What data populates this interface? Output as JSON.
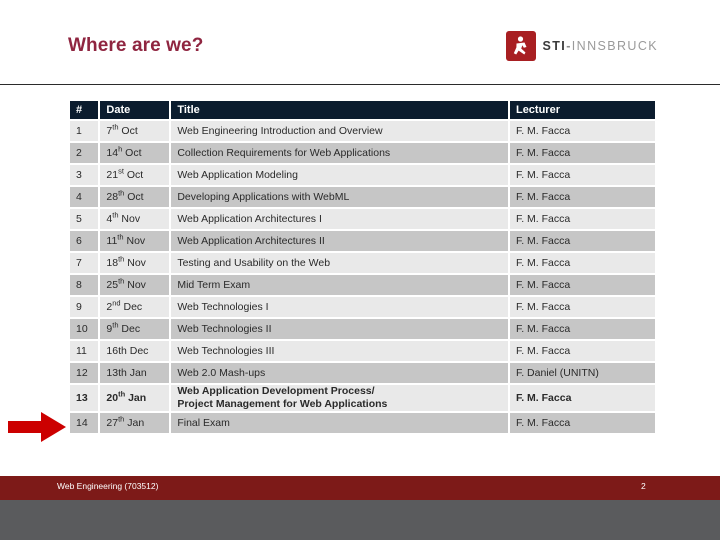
{
  "slide": {
    "title": "Where are we?",
    "brand": {
      "mark_icon": "sti-runner-logo-icon",
      "mark_color": "#a81f22",
      "name": "STI",
      "separator": "-",
      "city": "INNSBRUCK"
    }
  },
  "table": {
    "columns": [
      "#",
      "Date",
      "Title",
      "Lecturer"
    ],
    "header_bg": "#0b1c2e",
    "row_light_bg": "#e9e9e9",
    "row_dark_bg": "#c6c6c6",
    "highlight_color": "#ea1c1c",
    "rows": [
      {
        "num": "1",
        "date_num": "7",
        "date_sup": "th",
        "date_rest": " Oct",
        "title": "Web Engineering Introduction and Overview",
        "lecturer": "F. M. Facca"
      },
      {
        "num": "2",
        "date_num": "14",
        "date_sup": "h",
        "date_rest": " Oct",
        "title": "Collection Requirements for Web Applications",
        "lecturer": "F. M. Facca"
      },
      {
        "num": "3",
        "date_num": "21",
        "date_sup": "st",
        "date_rest": " Oct",
        "title": "Web Application Modeling",
        "lecturer": "F. M. Facca"
      },
      {
        "num": "4",
        "date_num": "28",
        "date_sup": "th",
        "date_rest": " Oct",
        "title": "Developing Applications with WebML",
        "lecturer": "F. M. Facca"
      },
      {
        "num": "5",
        "date_num": "4",
        "date_sup": "th",
        "date_rest": " Nov",
        "title": "Web Application Architectures I",
        "lecturer": "F. M. Facca"
      },
      {
        "num": "6",
        "date_num": "11",
        "date_sup": "th",
        "date_rest": " Nov",
        "title": "Web Application Architectures II",
        "lecturer": "F. M. Facca"
      },
      {
        "num": "7",
        "date_num": "18",
        "date_sup": "th",
        "date_rest": " Nov",
        "title": "Testing and Usability on the Web",
        "lecturer": "F. M. Facca"
      },
      {
        "num": "8",
        "date_num": "25",
        "date_sup": "th",
        "date_rest": " Nov",
        "title": "Mid Term Exam",
        "lecturer": "F. M. Facca"
      },
      {
        "num": "9",
        "date_num": "2",
        "date_sup": "nd",
        "date_rest": " Dec",
        "title": "Web Technologies I",
        "lecturer": "F. M. Facca"
      },
      {
        "num": "10",
        "date_num": "9",
        "date_sup": "th",
        "date_rest": " Dec",
        "title": "Web Technologies II",
        "lecturer": "F. M. Facca"
      },
      {
        "num": "11",
        "date_num": "16th Dec",
        "date_sup": "",
        "date_rest": "",
        "title": "Web Technologies III",
        "lecturer": "F. M. Facca"
      },
      {
        "num": "12",
        "date_num": "13th Jan",
        "date_sup": "",
        "date_rest": "",
        "title": "Web 2.0 Mash-ups",
        "lecturer": "F. Daniel (UNITN)"
      },
      {
        "num": "13",
        "date_num": "20",
        "date_sup": "th",
        "date_rest": " Jan",
        "title": "Web Application Development Process/\nProject Management for Web Applications",
        "lecturer": "F. M. Facca",
        "highlight": true
      },
      {
        "num": "14",
        "date_num": "27",
        "date_sup": "th",
        "date_rest": " Jan",
        "title": "Final Exam",
        "lecturer": "F. M. Facca"
      }
    ]
  },
  "marker": {
    "icon": "red-right-arrow-icon",
    "color": "#cc0000"
  },
  "footer": {
    "course": "Web Engineering (703512)",
    "page": "2",
    "bar_color": "#7d1a18",
    "bottom_color": "#5a5b5d"
  }
}
